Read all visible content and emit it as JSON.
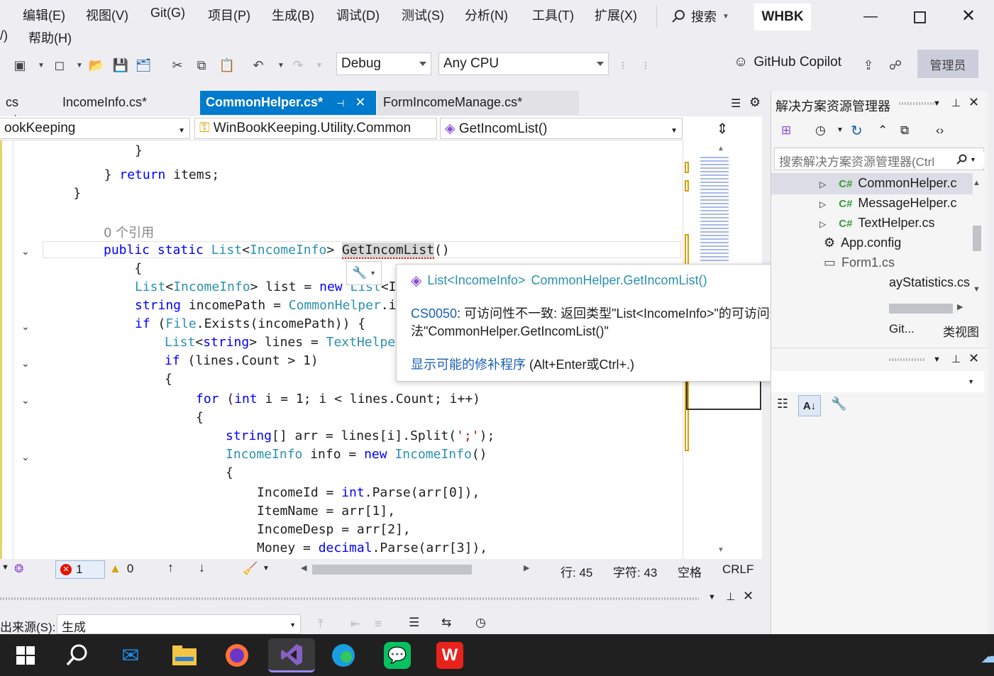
{
  "menubar": {
    "items": [
      "编辑(E)",
      "视图(V)",
      "Git(G)",
      "项目(P)",
      "生成(B)",
      "调试(D)",
      "测试(S)",
      "分析(N)",
      "工具(T)",
      "扩展(X)"
    ],
    "row2_prefix": "/)",
    "help": "帮助(H)",
    "search": "搜索",
    "workspace": "WHBK"
  },
  "toolbar": {
    "config": "Debug",
    "platform": "Any CPU",
    "copilot": "GitHub Copilot",
    "admin": "管理员"
  },
  "tabs": [
    {
      "label": "cs",
      "active": false
    },
    {
      "label": "IncomeInfo.cs*",
      "active": false
    },
    {
      "label": "CommonHelper.cs*",
      "active": true
    },
    {
      "label": "FormIncomeManage.cs*",
      "active": false
    }
  ],
  "navbar": {
    "project": "ookKeeping",
    "class": "WinBookKeeping.Utility.Common",
    "member": "GetIncomList()"
  },
  "editor": {
    "ref_count": "0 个引用",
    "lines": [
      "            }",
      "        } return items;",
      "    }",
      "",
      "    0 个引用",
      "    public static List<IncomeInfo> GetIncomList()",
      "    {",
      "        List<IncomeInfo> list = new List<In",
      "        string incomePath = CommonHelper.in",
      "        if (File.Exists(incomePath)) {",
      "            List<string> lines = TextHelper",
      "            if (lines.Count > 1)",
      "            {",
      "                for (int i = 1; i < lines.Count; i++)",
      "                {",
      "                    string[] arr = lines[i].Split(';');",
      "                    IncomeInfo info = new IncomeInfo()",
      "                    {",
      "                        IncomeId = int.Parse(arr[0]),",
      "                        ItemName = arr[1],",
      "                        IncomeDesp = arr[2],",
      "                        Money = decimal.Parse(arr[3]),"
    ]
  },
  "tooltip": {
    "signature_type": "List<IncomeInfo>",
    "signature_method": "CommonHelper.GetIncomList()",
    "error_code": "CS0050",
    "error_text": ": 可访问性不一致: 返回类型\"List<IncomeInfo>\"的可访问性低于方法\"CommonHelper.GetIncomList()\"",
    "fix_link": "显示可能的修补程序",
    "fix_shortcut": " (Alt+Enter或Ctrl+.)"
  },
  "statusbar": {
    "errors": "1",
    "warnings": "0",
    "line": "行: 45",
    "col": "字符: 43",
    "spaces": "空格",
    "eol": "CRLF"
  },
  "output": {
    "source_label": "出来源(S):",
    "source_value": "生成"
  },
  "solution_explorer": {
    "title": "解决方案资源管理器",
    "search_placeholder": "搜索解决方案资源管理器(Ctrl",
    "items": [
      {
        "icon": "C#",
        "label": "CommonHelper.c"
      },
      {
        "icon": "C#",
        "label": "MessageHelper.c"
      },
      {
        "icon": "C#",
        "label": "TextHelper.cs"
      },
      {
        "icon": "",
        "label": "App.config"
      },
      {
        "icon": "",
        "label": "Form1.cs"
      },
      {
        "icon": "",
        "label": "ayStatistics.cs"
      }
    ],
    "bottom_tabs": [
      "Git...",
      "类视图"
    ]
  },
  "colors": {
    "accent": "#007acc",
    "keyword": "#0000ff",
    "type": "#2b91af",
    "error": "#e51400"
  }
}
